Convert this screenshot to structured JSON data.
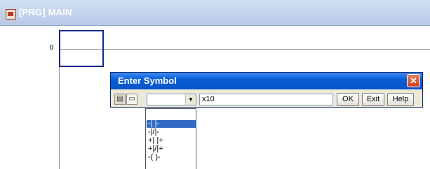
{
  "main_window": {
    "title": "[PRG] MAIN",
    "rung_number": "0"
  },
  "dialog": {
    "title": "Enter Symbol",
    "close_glyph": "✕",
    "device_value": "x10",
    "ok_label": "OK",
    "exit_label": "Exit",
    "help_label": "Help",
    "symbol_select_value": ""
  },
  "symbol_list": {
    "items": [
      "-| |-",
      "-|/|-",
      "+| |+",
      "+|/|+",
      "-( )-"
    ],
    "selected_index": 0
  },
  "icons": [
    "app-icon",
    "symbol-list-icon",
    "comment-icon",
    "chevron-down-icon",
    "close-icon"
  ]
}
